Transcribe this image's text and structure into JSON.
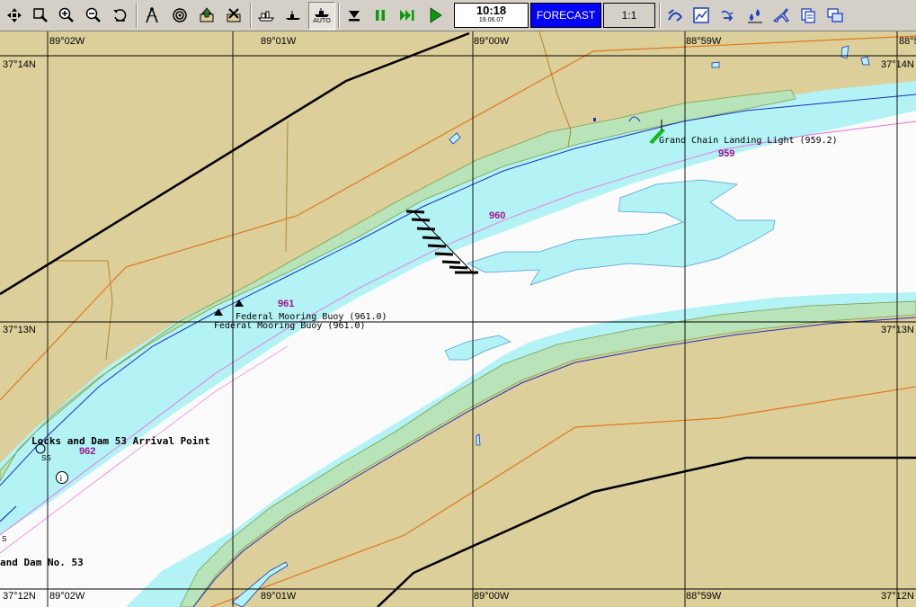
{
  "toolbar": {
    "time": "10:18",
    "date": "19.06.07",
    "mode_button": "FORECAST",
    "scale_button": "1:1",
    "auto_label": "AUTO"
  },
  "map": {
    "longitudes_top": [
      "89°02W",
      "89°01W",
      "89°00W",
      "88°59W",
      "88°5"
    ],
    "longitudes_bottom": [
      "89°02W",
      "89°01W",
      "89°00W",
      "88°59W"
    ],
    "lat_top_left": "37°14N",
    "lat_top_right": "37°14N",
    "lat_mid_left": "37°13N",
    "lat_mid_right": "37°13N",
    "lat_bottom_left": "37°12N",
    "lat_bottom_right": "37°12N",
    "river_miles": [
      "959",
      "960",
      "961",
      "962"
    ],
    "labels": {
      "grand_chain": "Grand Chain Landing Light (959.2)",
      "mooring_1": "Federal Mooring Buoy (961.0)",
      "mooring_2": "Federal Mooring Buoy (961.0)",
      "locks_arrival": "Locks and Dam 53 Arrival Point",
      "dam_53": "and Dam No. 53",
      "ss": "SS",
      "s": "S",
      "info_symbol": "i"
    },
    "colors": {
      "land": "#dccf9a",
      "water": "#b3f3f6",
      "channel": "#fbfbfb",
      "shore": "#b9e3b8",
      "mile_magenta": "#a0148c"
    }
  }
}
